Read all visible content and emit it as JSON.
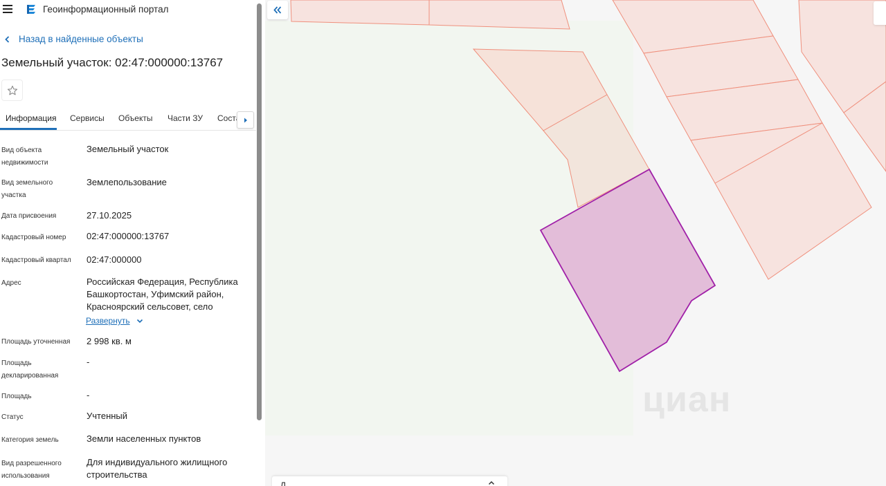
{
  "header": {
    "app_title": "Геоинформационный портал"
  },
  "nav": {
    "back_label": "Назад в найденные объекты"
  },
  "object": {
    "title": "Земельный участок: 02:47:000000:13767"
  },
  "tabs": [
    {
      "label": "Информация",
      "active": true
    },
    {
      "label": "Сервисы",
      "active": false
    },
    {
      "label": "Объекты",
      "active": false
    },
    {
      "label": "Части ЗУ",
      "active": false
    },
    {
      "label": "Соста…",
      "active": false
    }
  ],
  "properties": [
    {
      "label": "Вид объекта недвижимости",
      "value": "Земельный участок"
    },
    {
      "label": "Вид земельного участка",
      "value": "Землепользование"
    },
    {
      "label": "Дата присвоения",
      "value": "27.10.2025"
    },
    {
      "label": "Кадастровый номер",
      "value": "02:47:000000:13767"
    },
    {
      "label": "Кадастровый квартал",
      "value": "02:47:000000"
    },
    {
      "label": "Адрес",
      "value": "Российская Федерация, Республика Башкортостан, Уфимский район, Красноярский сельсовет, село"
    },
    {
      "label": "Площадь уточненная",
      "value": "2 998 кв. м"
    },
    {
      "label": "Площадь декларированная",
      "value": "-"
    },
    {
      "label": "Площадь",
      "value": "-"
    },
    {
      "label": "Статус",
      "value": "Учтенный"
    },
    {
      "label": "Категория земель",
      "value": "Земли населенных пунктов"
    },
    {
      "label": "Вид разрешенного использования",
      "value": "Для индивидуального жилищного строительства"
    }
  ],
  "address_expand_label": "Развернуть",
  "map": {
    "watermark": "циан",
    "bottom_panel_label": "Л",
    "colors": {
      "parcel_fill": "#f7e3df",
      "parcel_stroke": "#ef8f7c",
      "selected_fill": "#e3bdd9",
      "selected_stroke": "#a020a8",
      "green_area": "#f2f6f0",
      "accent": "#1e6fb8"
    }
  },
  "icons": {
    "menu": "menu-icon",
    "logo": "portal-logo-icon",
    "back": "chevron-left-icon",
    "favorite": "star-icon",
    "tab_scroll": "chevron-right-icon",
    "expand": "chevron-down-icon",
    "collapse_panel": "double-chevron-left-icon"
  }
}
